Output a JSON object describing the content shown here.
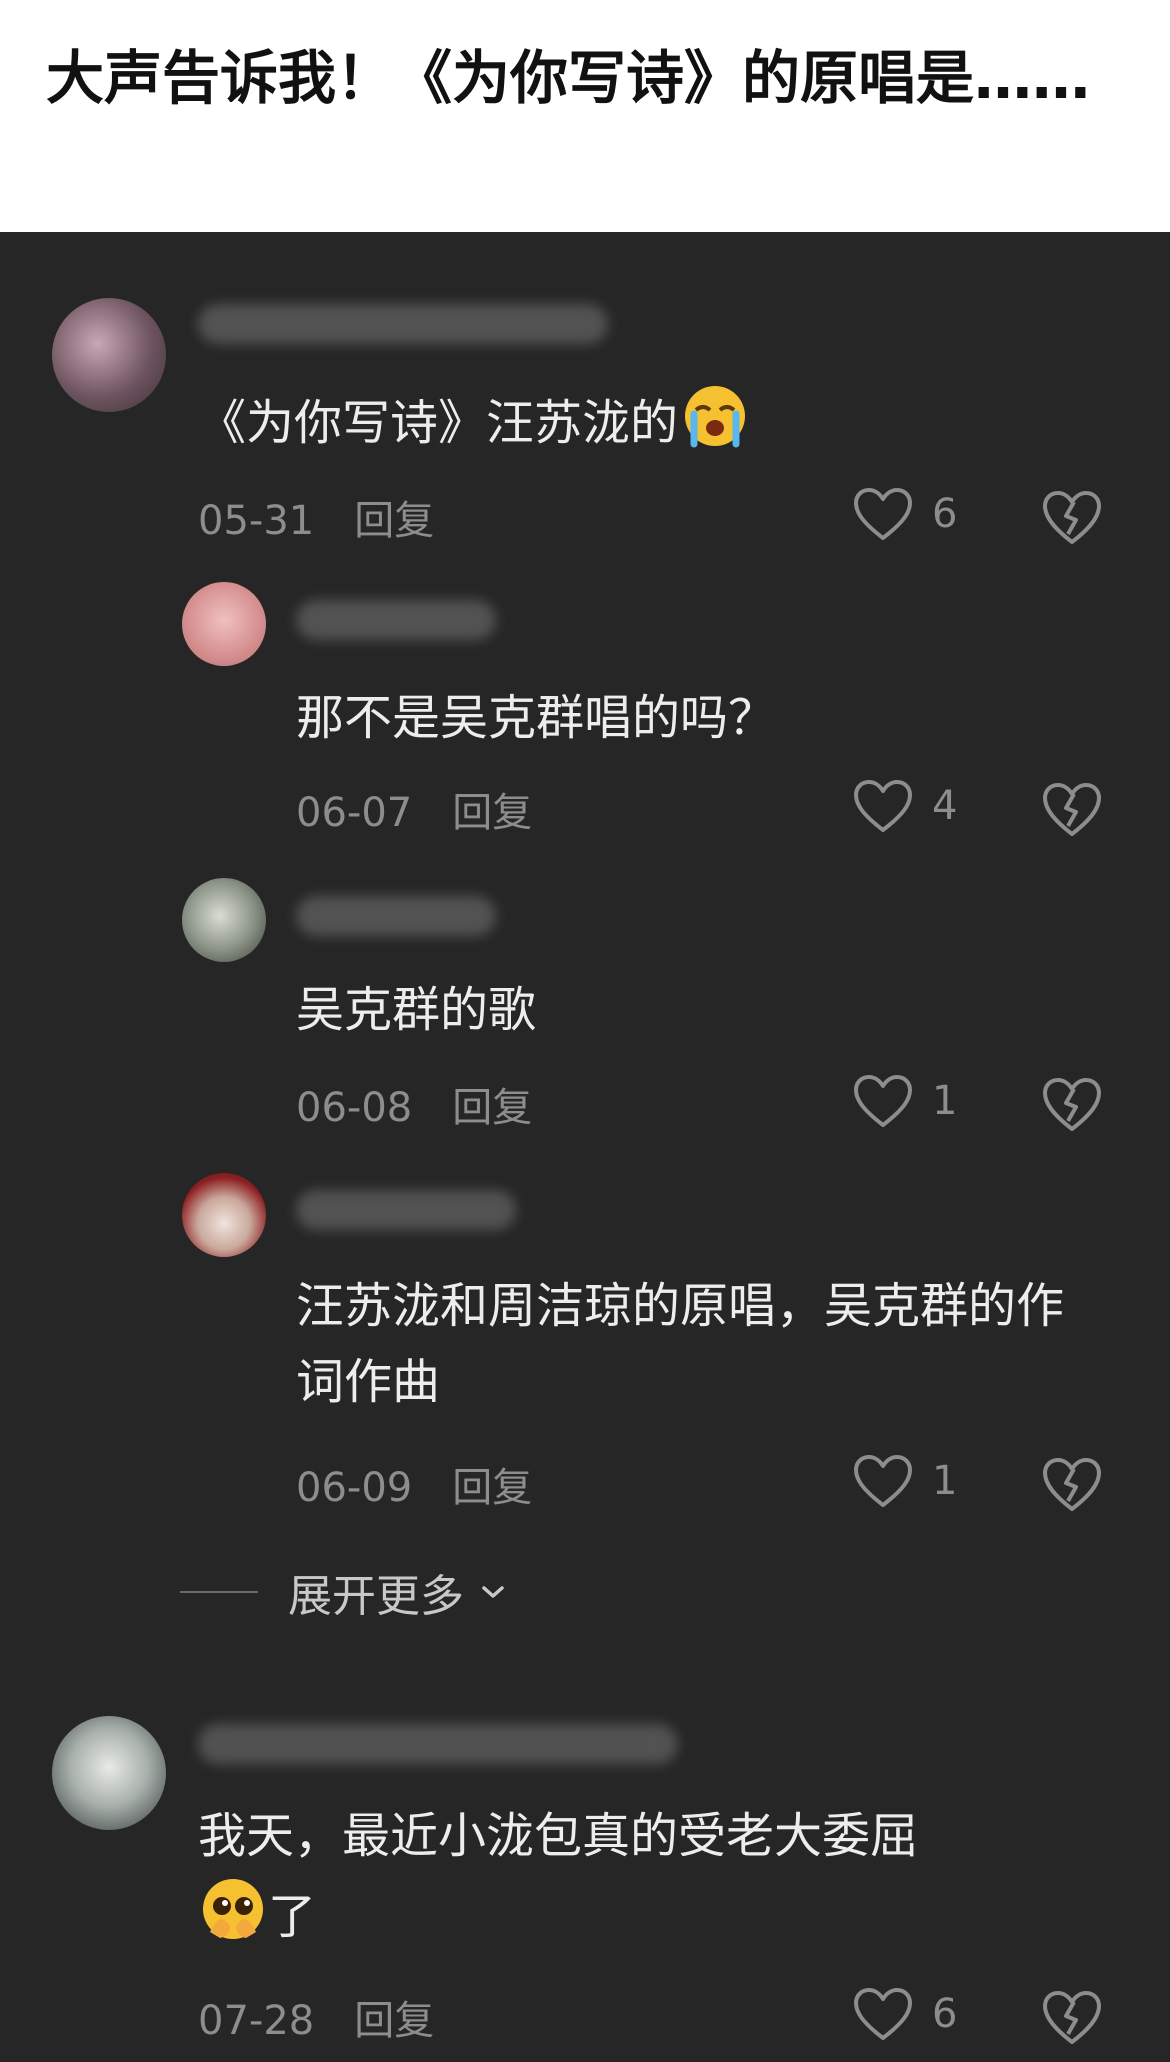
{
  "header": {
    "title": "大声告诉我！《为你写诗》的原唱是……"
  },
  "comments": [
    {
      "text": "《为你写诗》汪苏泷的",
      "date": "05-31",
      "reply_label": "回复",
      "likes": "6"
    },
    {
      "text": "那不是吴克群唱的吗？",
      "date": "06-07",
      "reply_label": "回复",
      "likes": "4"
    },
    {
      "text": "吴克群的歌",
      "date": "06-08",
      "reply_label": "回复",
      "likes": "1"
    },
    {
      "text": "汪苏泷和周洁琼的原唱，吴克群的作词作曲",
      "date": "06-09",
      "reply_label": "回复",
      "likes": "1"
    },
    {
      "text": "我天，最近小泷包真的受老大委屈",
      "text_after_emoji": "了",
      "date": "07-28",
      "reply_label": "回复",
      "likes": "6"
    }
  ],
  "expand": {
    "label": "展开更多"
  },
  "icons": {
    "like": "heart-outline-icon",
    "dislike": "broken-heart-icon",
    "expand": "chevron-down-icon",
    "emoji_1": "loudly-crying-face-emoji",
    "emoji_2": "pleading-face-emoji"
  },
  "colors": {
    "background": "#262626",
    "header_bg": "#ffffff",
    "text": "#ededed",
    "meta": "#8d8d8d"
  }
}
